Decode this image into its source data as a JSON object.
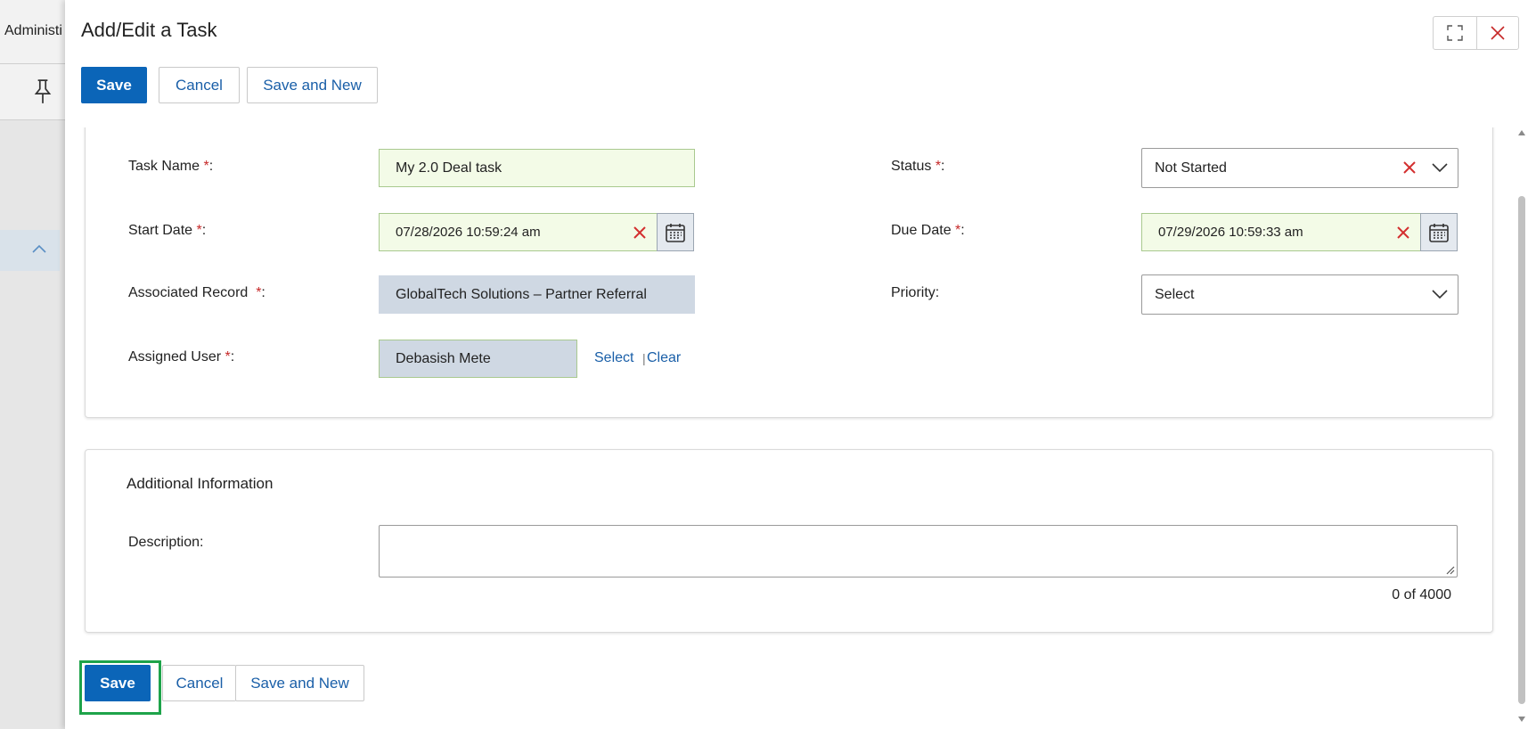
{
  "background": {
    "admin_label": "Administi"
  },
  "dialog": {
    "title": "Add/Edit a Task",
    "top_buttons": {
      "save": "Save",
      "cancel": "Cancel",
      "save_new": "Save and New"
    },
    "bottom_buttons": {
      "save": "Save",
      "cancel": "Cancel",
      "save_new": "Save and New"
    }
  },
  "form": {
    "task_name": {
      "label": "Task Name",
      "required": "*",
      "colon": ":",
      "value": "My 2.0 Deal task"
    },
    "status": {
      "label": "Status",
      "required": "*",
      "colon": ":",
      "value": "Not Started"
    },
    "start_date": {
      "label": "Start Date",
      "required": "*",
      "colon": ":",
      "value": "07/28/2026 10:59:24 am"
    },
    "due_date": {
      "label": "Due Date",
      "required": "*",
      "colon": ":",
      "value": "07/29/2026 10:59:33 am"
    },
    "associated_record": {
      "label": "Associated Record",
      "required": "*",
      "colon": ":",
      "value": "GlobalTech Solutions – Partner Referral"
    },
    "priority": {
      "label": "Priority:",
      "value": "Select"
    },
    "assigned_user": {
      "label": "Assigned User",
      "required": "*",
      "colon": ":",
      "value": "Debasish Mete",
      "select_link": "Select",
      "separator": "|",
      "clear_link": "Clear"
    }
  },
  "additional": {
    "title": "Additional Information",
    "description_label": "Description:",
    "description_value": "",
    "counter": "0 of 4000"
  },
  "colors": {
    "primary": "#0b65b8",
    "required": "#c62828",
    "focus": "#1ea34a",
    "field_bg": "#f3fbe7",
    "readonly_bg": "#cfd8e3"
  }
}
